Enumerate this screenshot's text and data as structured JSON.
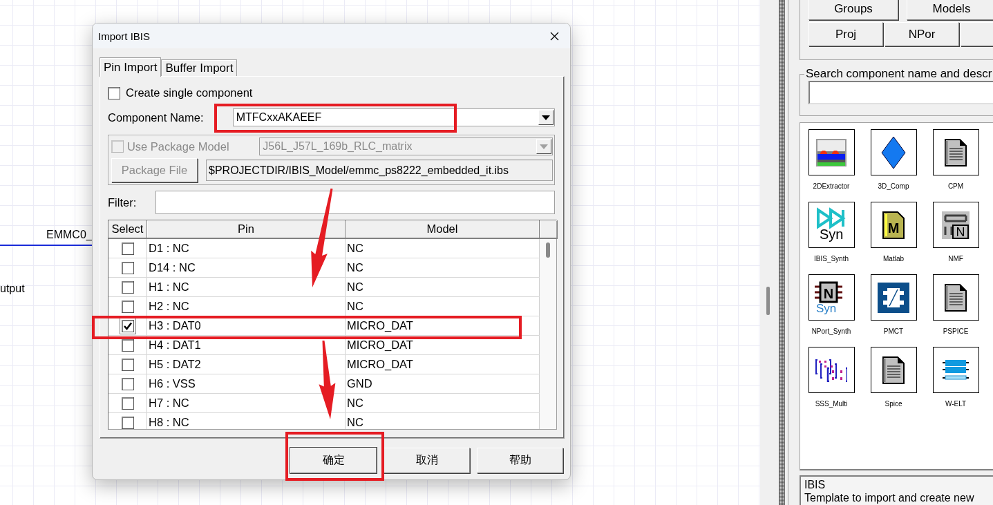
{
  "canvas": {
    "labels": [
      {
        "text": "EMMC0_"
      },
      {
        "text": "utput"
      }
    ]
  },
  "dialog": {
    "title": "Import IBIS",
    "tabs": [
      {
        "label": "Pin Import",
        "selected": true
      },
      {
        "label": "Buffer Import",
        "selected": false
      }
    ],
    "create_single_component": {
      "label": "Create single component",
      "checked": false
    },
    "component_name": {
      "label": "Component Name:",
      "value": "MTFCxxAKAEEF"
    },
    "package": {
      "disabled": true,
      "use_package_model": {
        "label": "Use Package Model",
        "checked": false
      },
      "package_model": "J56L_J57L_169b_RLC_matrix",
      "package_file_button": "Package File",
      "package_file": "$PROJECTDIR/IBIS_Model/emmc_ps8222_embedded_it.ibs"
    },
    "filter": {
      "label": "Filter:"
    },
    "table": {
      "columns": [
        "Select",
        "Pin",
        "Model"
      ],
      "rows": [
        {
          "checked": false,
          "focused": false,
          "pin": "D1 : NC",
          "model": "NC"
        },
        {
          "checked": false,
          "focused": false,
          "pin": "D14 : NC",
          "model": "NC"
        },
        {
          "checked": false,
          "focused": false,
          "pin": "H1 : NC",
          "model": "NC"
        },
        {
          "checked": false,
          "focused": false,
          "pin": "H2 : NC",
          "model": "NC"
        },
        {
          "checked": true,
          "focused": true,
          "pin": "H3 : DAT0",
          "model": "MICRO_DAT"
        },
        {
          "checked": false,
          "focused": false,
          "pin": "H4 : DAT1",
          "model": "MICRO_DAT"
        },
        {
          "checked": false,
          "focused": false,
          "pin": "H5 : DAT2",
          "model": "MICRO_DAT"
        },
        {
          "checked": false,
          "focused": false,
          "pin": "H6 : VSS",
          "model": "GND"
        },
        {
          "checked": false,
          "focused": false,
          "pin": "H7 : NC",
          "model": "NC"
        },
        {
          "checked": false,
          "focused": false,
          "pin": "H8 : NC",
          "model": "NC"
        }
      ]
    },
    "buttons": [
      "确定",
      "取消",
      "帮助"
    ]
  },
  "library": {
    "button_rows": [
      [
        {
          "kind": "labeled",
          "label": "Groups"
        },
        {
          "kind": "labeled",
          "label": "Models"
        }
      ],
      [
        {
          "kind": "labeled",
          "label": "Proj"
        },
        {
          "kind": "labeled",
          "label": "NPor"
        },
        {
          "kind": "blank"
        }
      ]
    ],
    "search": {
      "label": "Search component name and descr"
    },
    "components": [
      {
        "name": "2DExtractor"
      },
      {
        "name": "3D_Comp"
      },
      {
        "name": "CPM"
      },
      {
        "name": "IBIS_Synth",
        "icon_texts": [
          "Syn"
        ]
      },
      {
        "name": "Matlab",
        "icon_texts": [
          "M"
        ]
      },
      {
        "name": "NMF",
        "icon_texts": [
          "N"
        ]
      },
      {
        "name": "NPort_Synth",
        "icon_texts": [
          "N",
          "Syn"
        ]
      },
      {
        "name": "PMCT"
      },
      {
        "name": "PSPICE"
      },
      {
        "name": "SSS_Multi"
      },
      {
        "name": "Spice"
      },
      {
        "name": "W-ELT"
      }
    ],
    "description": {
      "title": "IBIS",
      "text": "Template to import and create new"
    }
  },
  "annotations": [
    {
      "kind": "box"
    },
    {
      "kind": "box"
    },
    {
      "kind": "box"
    },
    {
      "kind": "arrow"
    },
    {
      "kind": "arrow"
    }
  ]
}
